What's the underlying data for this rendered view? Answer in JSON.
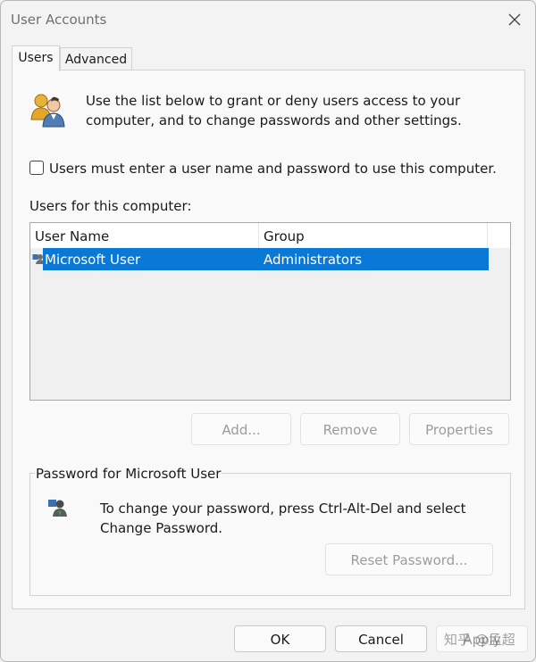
{
  "window": {
    "title": "User Accounts"
  },
  "tabs": [
    {
      "label": "Users",
      "active": true
    },
    {
      "label": "Advanced",
      "active": false
    }
  ],
  "users_tab": {
    "intro_text": "Use the list below to grant or deny users access to your computer, and to change passwords and other settings.",
    "require_login_checkbox": {
      "label": "Users must enter a user name and password to use this computer.",
      "checked": false
    },
    "users_list_label": "Users for this computer:",
    "columns": [
      "User Name",
      "Group"
    ],
    "rows": [
      {
        "user_name": "Microsoft User",
        "group": "Administrators",
        "selected": true
      }
    ],
    "buttons": {
      "add": "Add...",
      "remove": "Remove",
      "properties": "Properties"
    },
    "password_group": {
      "title": "Password for Microsoft User",
      "text": "To change your password, press Ctrl-Alt-Del and select Change Password.",
      "reset_button": "Reset Password..."
    }
  },
  "footer": {
    "ok": "OK",
    "cancel": "Cancel",
    "apply": "Apply"
  },
  "watermark": "知乎 @孟超",
  "colors": {
    "selection": "#0a78d7",
    "window_bg": "#f3f3f3",
    "panel_bg": "#f9f9f9",
    "disabled_text": "#9c9c9c"
  }
}
